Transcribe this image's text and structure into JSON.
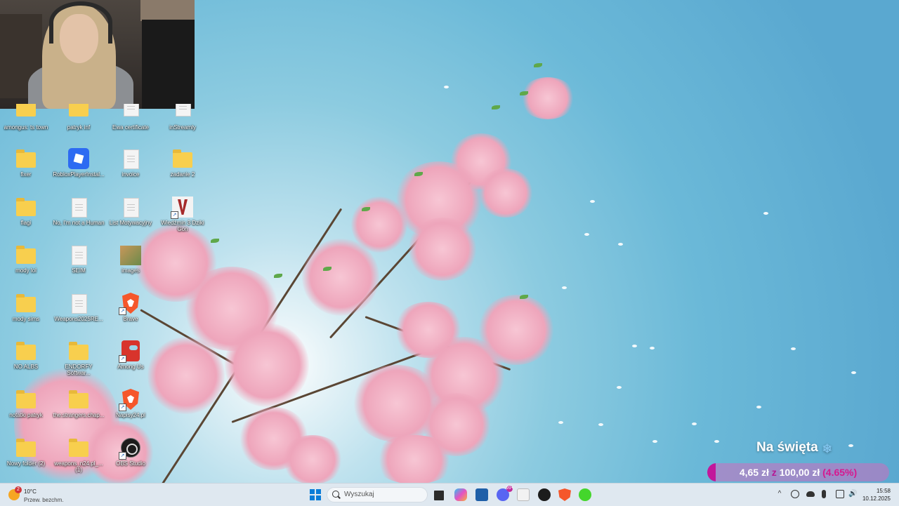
{
  "desktop": {
    "icons": [
      {
        "label": "amongus: ts town",
        "type": "folder"
      },
      {
        "label": "patryk inf",
        "type": "folder"
      },
      {
        "label": "Ewa certificate",
        "type": "doc"
      },
      {
        "label": "inStreamly",
        "type": "doc"
      },
      {
        "label": "fixer",
        "type": "folder"
      },
      {
        "label": "RobloxPlayerInstal...",
        "type": "roblox"
      },
      {
        "label": "invoice",
        "type": "doc"
      },
      {
        "label": "zadanie 2",
        "type": "folder"
      },
      {
        "label": "flagi",
        "type": "folder"
      },
      {
        "label": "No, I'm not a Human",
        "type": "doc"
      },
      {
        "label": "List Motywacyjny",
        "type": "doc"
      },
      {
        "label": "Wiedźmin 3 Dziki Gon",
        "type": "witcher"
      },
      {
        "label": "mody lol",
        "type": "folder"
      },
      {
        "label": "SEIM",
        "type": "doc"
      },
      {
        "label": "images",
        "type": "image"
      },
      {
        "label": "mody sims",
        "type": "folder"
      },
      {
        "label": "Weapons2025RE...",
        "type": "doc"
      },
      {
        "label": "Brave",
        "type": "brave"
      },
      {
        "label": "NO ALBS",
        "type": "folder"
      },
      {
        "label": "ENDORFY Softwar...",
        "type": "folder"
      },
      {
        "label": "Among Us",
        "type": "amongus"
      },
      {
        "label": "notatki patryk",
        "type": "folder"
      },
      {
        "label": "the.strangers.chap...",
        "type": "folder"
      },
      {
        "label": "Napisy24.pl",
        "type": "brave"
      },
      {
        "label": "Nowy folder (2)",
        "type": "folder"
      },
      {
        "label": "weapons_n24.pl_... (1)",
        "type": "folder"
      },
      {
        "label": "OBS Studio",
        "type": "obs"
      }
    ]
  },
  "goal_widget": {
    "title": "Na święta",
    "snow_icon": "❄",
    "current": "4,65 zł",
    "separator": "z",
    "target": "100,00 zł",
    "percent_label": "(4.65%)",
    "progress": 4.65
  },
  "taskbar": {
    "weather_badge": "2",
    "temperature": "10°C",
    "weather_desc": "Przew. bezchm.",
    "search_placeholder": "Wyszukaj",
    "chevron": "^",
    "app_badge": "99+",
    "time": "15:58",
    "date": "10.12.2025"
  },
  "colors": {
    "accent": "#c2179b",
    "windows_blue": "#0a7cd8"
  }
}
